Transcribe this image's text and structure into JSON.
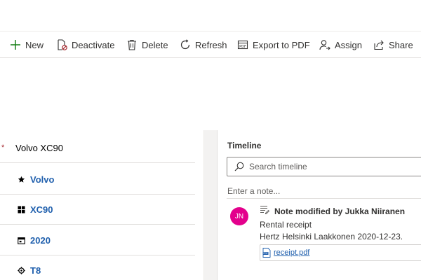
{
  "command_bar": {
    "new_label": "New",
    "deactivate_label": "Deactivate",
    "delete_label": "Delete",
    "refresh_label": "Refresh",
    "export_label": "Export to PDF",
    "assign_label": "Assign",
    "share_label": "Share"
  },
  "form": {
    "required_marker": "*",
    "title_value": "Volvo XC90",
    "fields": [
      {
        "icon": "star-icon",
        "value": "Volvo"
      },
      {
        "icon": "grid-icon",
        "value": "XC90"
      },
      {
        "icon": "calendar-icon",
        "value": "2020"
      },
      {
        "icon": "engine-icon",
        "value": "T8"
      }
    ]
  },
  "timeline": {
    "header": "Timeline",
    "search_placeholder": "Search timeline",
    "note_placeholder": "Enter a note...",
    "post": {
      "avatar_initials": "JN",
      "avatar_color": "#e3008c",
      "title": "Note modified by Jukka Niiranen",
      "subject": "Rental receipt",
      "body": "Hertz Helsinki Laakkonen 2020-12-23.",
      "attachment": "receipt.pdf"
    }
  },
  "colors": {
    "accent": "#1f5fad",
    "new_icon": "#107c10",
    "required": "#a4262c"
  }
}
